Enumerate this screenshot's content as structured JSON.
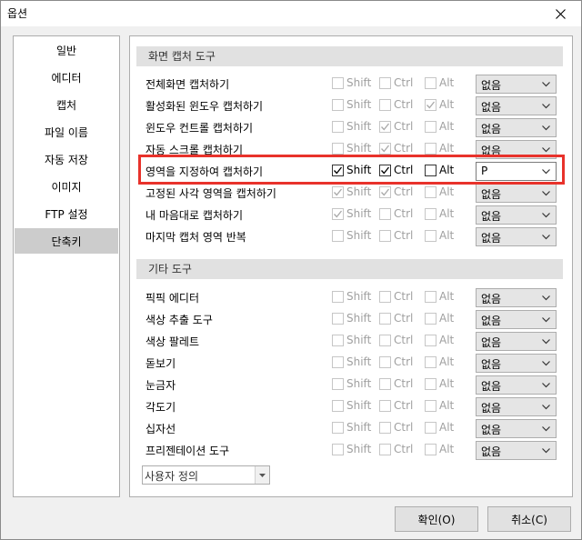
{
  "window": {
    "title": "옵션"
  },
  "sidebar": {
    "items": [
      {
        "label": "일반",
        "active": false
      },
      {
        "label": "에디터",
        "active": false
      },
      {
        "label": "캡처",
        "active": false
      },
      {
        "label": "파일 이름",
        "active": false
      },
      {
        "label": "자동 저장",
        "active": false
      },
      {
        "label": "이미지",
        "active": false
      },
      {
        "label": "FTP 설정",
        "active": false
      },
      {
        "label": "단축키",
        "active": true
      }
    ]
  },
  "modifiers": {
    "shift": "Shift",
    "ctrl": "Ctrl",
    "alt": "Alt"
  },
  "sections": [
    {
      "title": "화면 캡처 도구",
      "rows": [
        {
          "label": "전체화면 캡처하기",
          "shift": false,
          "ctrl": false,
          "alt": false,
          "key": "없음",
          "enabled": false
        },
        {
          "label": "활성화된 윈도우 캡처하기",
          "shift": false,
          "ctrl": false,
          "alt": true,
          "key": "없음",
          "enabled": false
        },
        {
          "label": "윈도우 컨트롤 캡처하기",
          "shift": false,
          "ctrl": true,
          "alt": false,
          "key": "없음",
          "enabled": false
        },
        {
          "label": "자동 스크롤 캡처하기",
          "shift": false,
          "ctrl": true,
          "alt": false,
          "key": "없음",
          "enabled": false
        },
        {
          "label": "영역을 지정하여 캡처하기",
          "shift": true,
          "ctrl": true,
          "alt": false,
          "key": "P",
          "enabled": true
        },
        {
          "label": "고정된 사각 영역을 캡처하기",
          "shift": true,
          "ctrl": true,
          "alt": false,
          "key": "없음",
          "enabled": false
        },
        {
          "label": "내 마음대로 캡처하기",
          "shift": true,
          "ctrl": false,
          "alt": false,
          "key": "없음",
          "enabled": false
        },
        {
          "label": "마지막 캡처 영역 반복",
          "shift": false,
          "ctrl": false,
          "alt": false,
          "key": "없음",
          "enabled": false
        }
      ]
    },
    {
      "title": "기타 도구",
      "rows": [
        {
          "label": "픽픽 에디터",
          "shift": false,
          "ctrl": false,
          "alt": false,
          "key": "없음",
          "enabled": false
        },
        {
          "label": "색상 추출 도구",
          "shift": false,
          "ctrl": false,
          "alt": false,
          "key": "없음",
          "enabled": false
        },
        {
          "label": "색상 팔레트",
          "shift": false,
          "ctrl": false,
          "alt": false,
          "key": "없음",
          "enabled": false
        },
        {
          "label": "돋보기",
          "shift": false,
          "ctrl": false,
          "alt": false,
          "key": "없음",
          "enabled": false
        },
        {
          "label": "눈금자",
          "shift": false,
          "ctrl": false,
          "alt": false,
          "key": "없음",
          "enabled": false
        },
        {
          "label": "각도기",
          "shift": false,
          "ctrl": false,
          "alt": false,
          "key": "없음",
          "enabled": false
        },
        {
          "label": "십자선",
          "shift": false,
          "ctrl": false,
          "alt": false,
          "key": "없음",
          "enabled": false
        },
        {
          "label": "프리젠테이션 도구",
          "shift": false,
          "ctrl": false,
          "alt": false,
          "key": "없음",
          "enabled": false
        }
      ]
    }
  ],
  "preset": {
    "value": "사용자 정의"
  },
  "buttons": {
    "ok": "확인(O)",
    "cancel": "취소(C)"
  },
  "colors": {
    "highlight": "#e8322b",
    "active_item": "#cccccc",
    "section_header": "#e1e1e1"
  },
  "icons": {
    "close": "close-icon",
    "dropdown": "chevron-down-icon",
    "check": "check-icon"
  }
}
